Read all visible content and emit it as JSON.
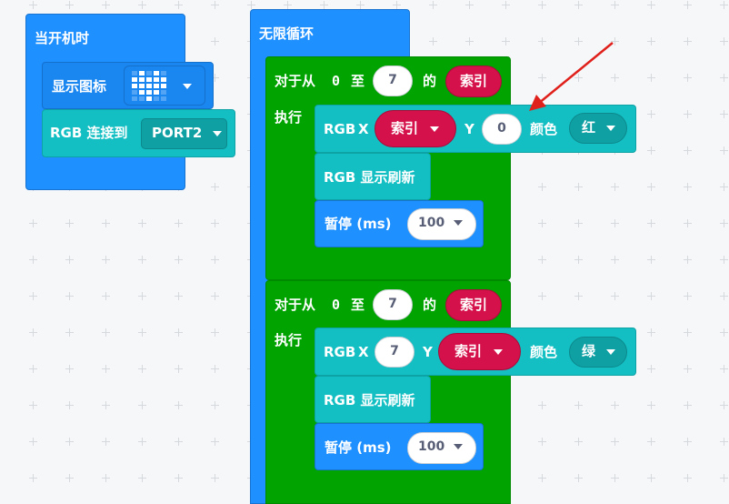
{
  "when_start": {
    "hat_label": "当开机时",
    "show_icon_label": "显示图标",
    "rgb_connect_label": "RGB 连接到",
    "port_value": "PORT2"
  },
  "forever": {
    "label": "无限循环"
  },
  "loop1": {
    "for_label": "对于从",
    "from": "0",
    "to_label": "至",
    "to_value": "7",
    "of_label": "的",
    "var_name": "索引",
    "do_label": "执行",
    "set_pixel": {
      "rgb": "RGB",
      "x_label": "X",
      "x_value": "索引",
      "y_label": "Y",
      "y_value": "0",
      "color_label": "颜色",
      "color_value": "红"
    },
    "refresh_label": "RGB 显示刷新",
    "pause_label": "暂停 (ms)",
    "pause_value": "100"
  },
  "loop2": {
    "for_label": "对于从",
    "from": "0",
    "to_label": "至",
    "to_value": "7",
    "of_label": "的",
    "var_name": "索引",
    "do_label": "执行",
    "set_pixel": {
      "rgb": "RGB",
      "x_label": "X",
      "x_value": "7",
      "y_label": "Y",
      "y_value": "索引",
      "color_label": "颜色",
      "color_value": "绿"
    },
    "refresh_label": "RGB 显示刷新",
    "pause_label": "暂停 (ms)",
    "pause_value": "100"
  },
  "colors": {
    "event_blue": "#1e90ff",
    "loop_green": "#00a300",
    "rgb_teal": "#13bfc3",
    "variable_red": "#d4114a",
    "arrow_red": "#e0201b"
  }
}
